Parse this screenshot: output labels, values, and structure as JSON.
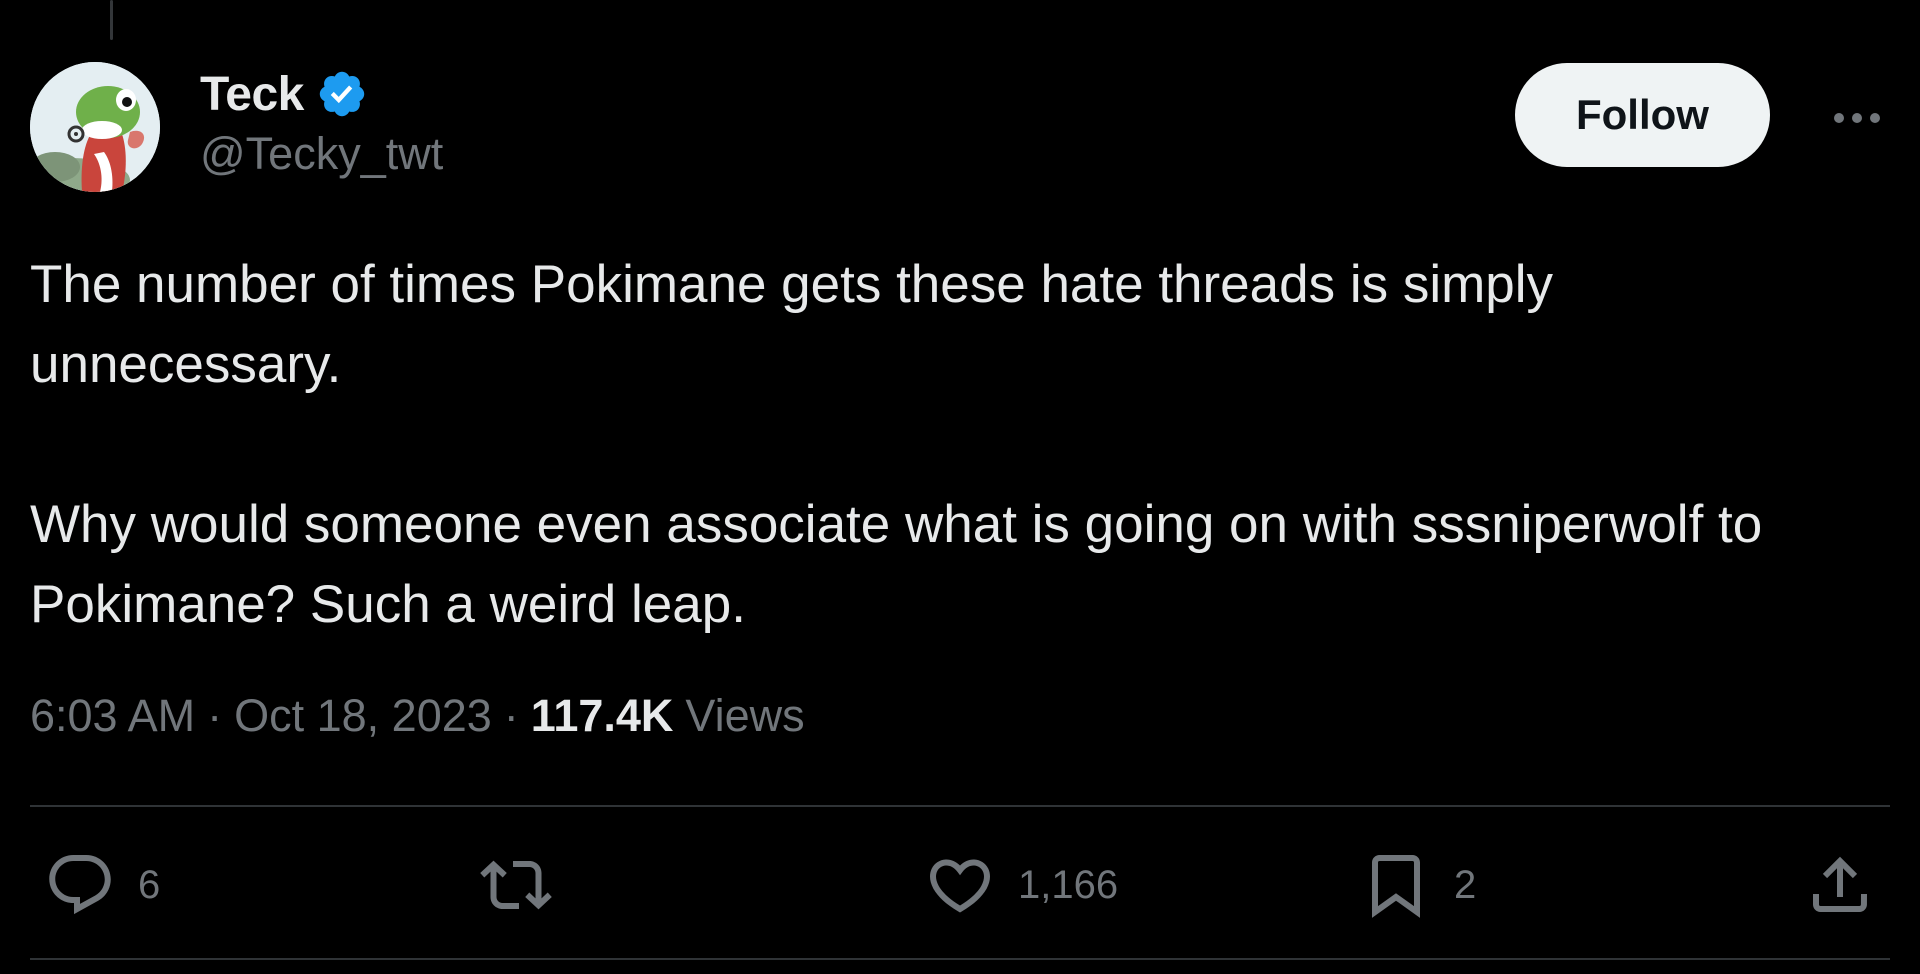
{
  "author": {
    "display_name": "Teck",
    "handle": "@Tecky_twt",
    "verified": true
  },
  "follow_button": {
    "label": "Follow"
  },
  "tweet": {
    "paragraphs": [
      "The number of times Pokimane gets these hate threads is simply unnecessary.",
      "Why would someone even associate what is going on with sssniperwolf to Pokimane? Such a weird leap."
    ]
  },
  "meta": {
    "time": "6:03 AM",
    "separator": "·",
    "date": "Oct 18, 2023",
    "views_count": "117.4K",
    "views_label": "Views"
  },
  "actions": {
    "reply_count": "6",
    "retweet_count": "",
    "like_count": "1,166",
    "bookmark_count": "2"
  },
  "icons": {
    "more": "more-icon",
    "verified": "verified-badge-icon",
    "reply": "reply-icon",
    "retweet": "retweet-icon",
    "like": "heart-icon",
    "bookmark": "bookmark-icon",
    "share": "share-icon"
  },
  "colors": {
    "background": "#000000",
    "primary_text": "#e7e9ea",
    "secondary_text": "#71767b",
    "verified_blue": "#1d9bf0",
    "follow_button_bg": "#eff3f4",
    "divider": "#2f3336"
  }
}
